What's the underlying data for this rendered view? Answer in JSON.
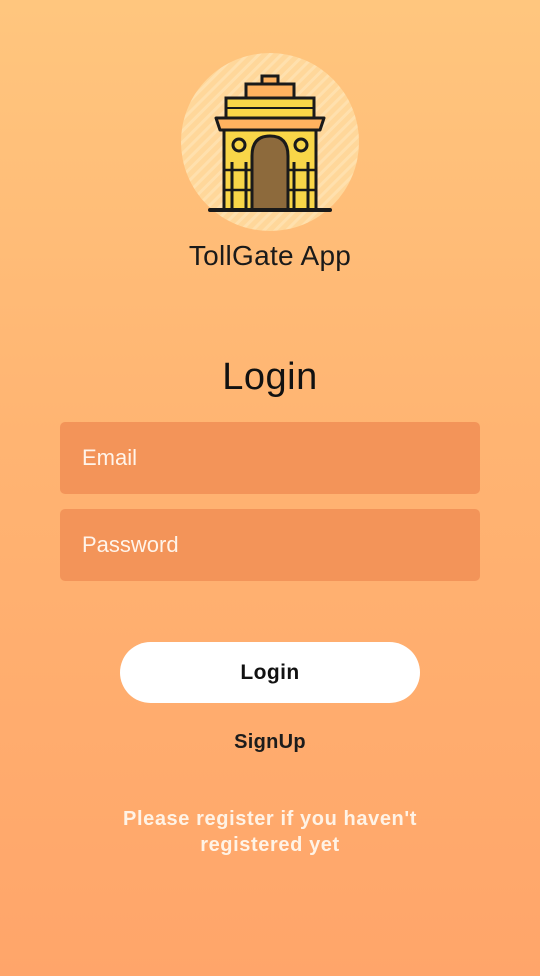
{
  "app": {
    "name": "TollGate App",
    "logo_icon": "india-gate-icon"
  },
  "login_form": {
    "title": "Login",
    "email_placeholder": "Email",
    "email_value": "",
    "password_placeholder": "Password",
    "password_value": "",
    "login_button_label": "Login",
    "signup_link_label": "SignUp",
    "register_note": "Please register if you haven't registered yet"
  },
  "colors": {
    "background_top": "#ffc67e",
    "background_bottom": "#ffa56a",
    "field_fill": "#f39459",
    "button_fill": "#ffffff"
  }
}
